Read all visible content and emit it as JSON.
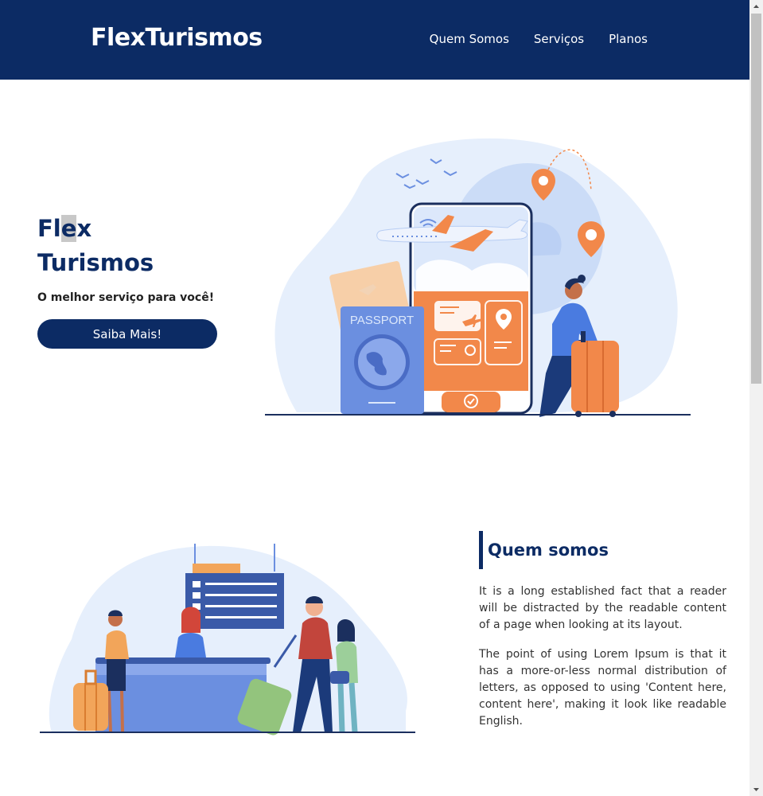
{
  "brand": {
    "logo": "FlexTurismos"
  },
  "nav": {
    "items": [
      "Quem Somos",
      "Serviços",
      "Planos"
    ]
  },
  "hero": {
    "title_part1_prefix": "Fl",
    "title_part1_selected": "e",
    "title_part1_suffix": "x",
    "title_part2": "Turismos",
    "subtitle": "O melhor serviço para você!",
    "cta": "Saiba Mais!",
    "passport_label": "PASSPORT"
  },
  "about": {
    "title": "Quem somos",
    "paragraphs": [
      "It is a long established fact that a reader will be distracted by the readable content of a page when looking at its layout.",
      "The point of using Lorem Ipsum is that it has a more-or-less normal distribution of letters, as opposed to using 'Content here, content here', making it look like readable English."
    ]
  },
  "colors": {
    "primary": "#0c2b64",
    "accent": "#f2884a",
    "light_blue": "#dce8fb",
    "illus_blue": "#6b8fe0"
  }
}
